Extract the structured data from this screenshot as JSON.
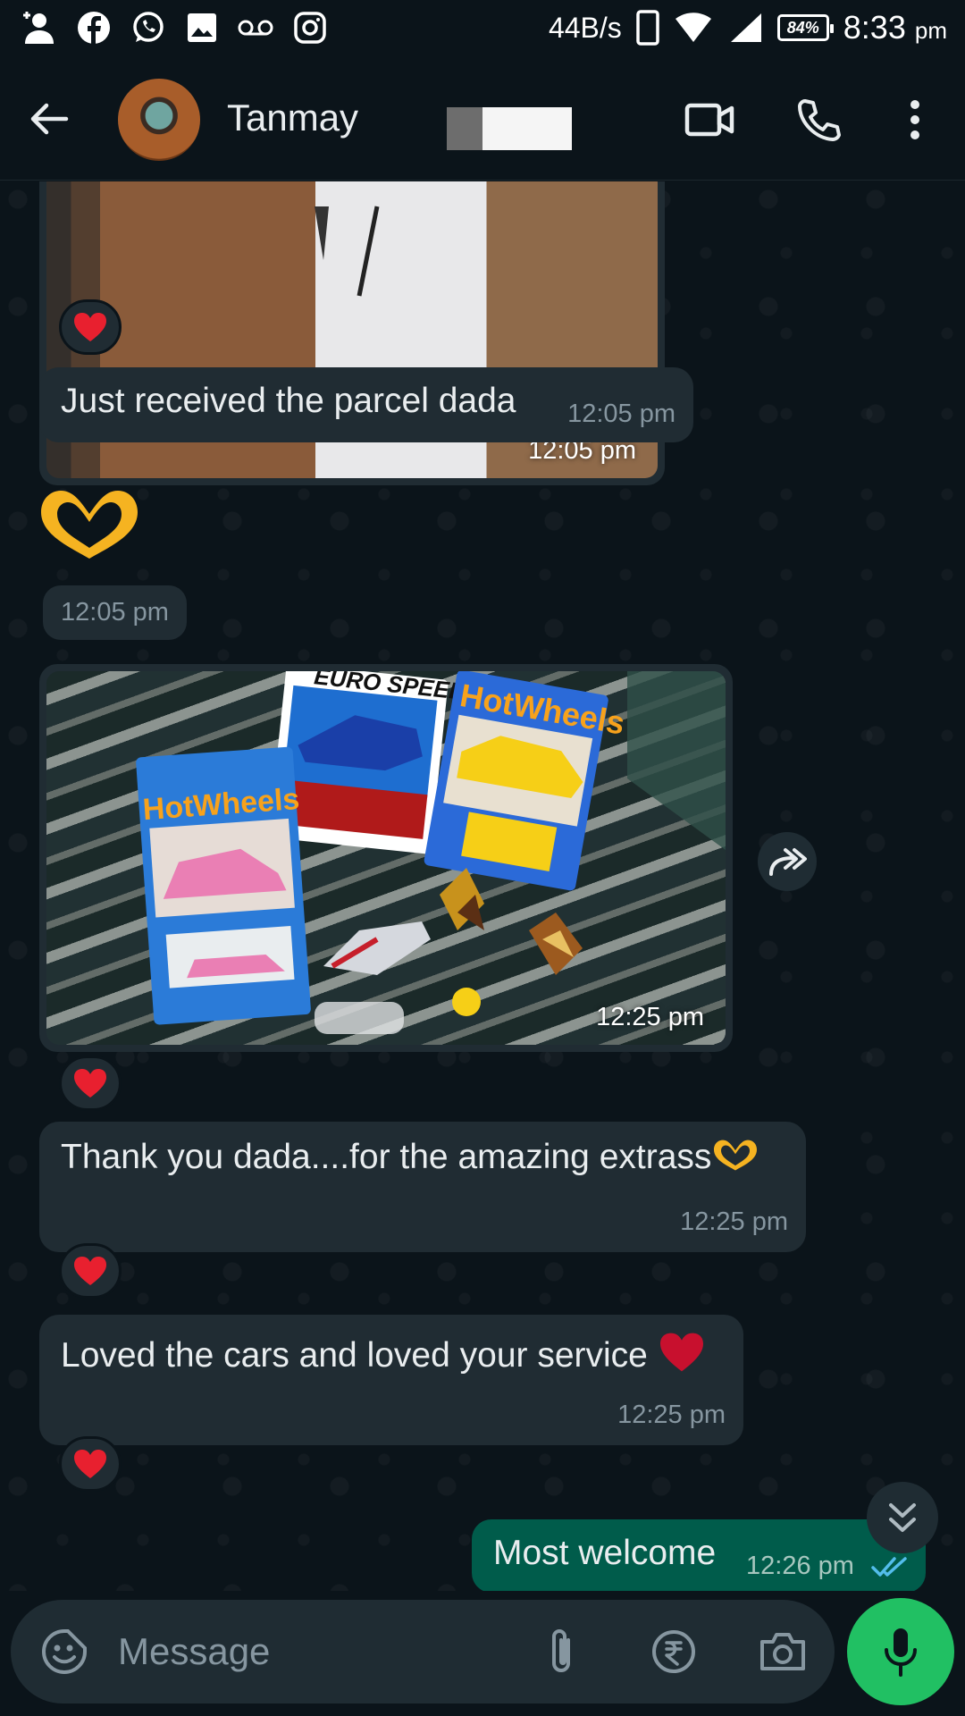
{
  "status_bar": {
    "net_speed": "44B/s",
    "battery": "84%",
    "time": "8:33",
    "time_suffix": "pm"
  },
  "header": {
    "contact_name": "Tanmay"
  },
  "messages": {
    "img1_time": "12:05 pm",
    "msg1_text": "Just received the parcel dada",
    "msg1_time": "12:05 pm",
    "emoji_time": "12:05 pm",
    "img2_time": "12:25 pm",
    "msg2_text": "Thank you dada....for the amazing extrass",
    "msg2_time": "12:25 pm",
    "msg3_text": "Loved the cars and loved your service",
    "msg3_time": "12:25 pm",
    "out_text": "Most welcome",
    "out_time": "12:26 pm"
  },
  "image_text": {
    "brand_left": "HotWheels",
    "brand_middle": "EURO SPEED",
    "brand_right": "HotWheels"
  },
  "input": {
    "placeholder": "Message"
  },
  "colors": {
    "background": "#0b141a",
    "incoming_bubble": "#202c33",
    "outgoing_bubble": "#005c4b",
    "accent_green": "#21c063",
    "read_ticks": "#53bdeb"
  }
}
